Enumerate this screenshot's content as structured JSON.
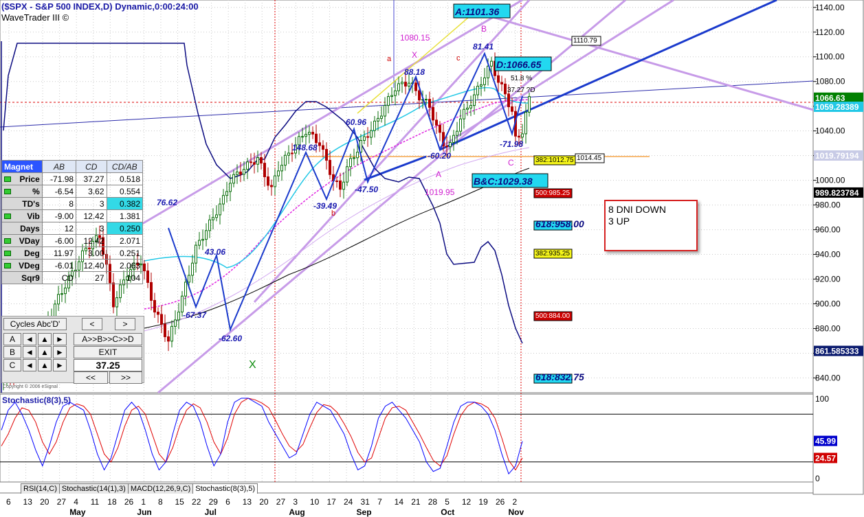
{
  "header": {
    "title": "($SPX - S&P 500 INDEX,D) Dynamic,0:00:24:00",
    "subtitle": "WaveTrader III ©"
  },
  "chart_data": {
    "type": "candlestick",
    "price_axis": {
      "ticks": [
        1140,
        1120,
        1100,
        1080,
        1060,
        1040,
        1020,
        1000,
        980,
        960,
        940,
        920,
        900,
        880,
        860,
        840
      ],
      "range": [
        828,
        1146
      ]
    },
    "price_axis_labels": [
      "1140.00",
      "1120.00",
      "1100.00",
      "1080.00",
      "1060.00",
      "1040.00",
      "1020.00",
      "1000.00",
      "980.00",
      "960.00",
      "940.00",
      "920.00",
      "900.00",
      "880.00",
      "860.00",
      "840.00"
    ],
    "value_tags": [
      {
        "text": "1066.63",
        "price": 1066.63,
        "color": "#008000",
        "text_color": "#ffffff"
      },
      {
        "text": "1059.28389",
        "price": 1059.28,
        "color": "#22c8e6",
        "text_color": "#ffffff"
      },
      {
        "text": "1019.79194",
        "price": 1019.79,
        "color": "#c8cbe6",
        "text_color": "#ffffff"
      },
      {
        "text": "989.823784",
        "price": 989.82,
        "color": "#000000",
        "text_color": "#ffffff"
      },
      {
        "text": "861.585333",
        "price": 861.59,
        "color": "#0a1a6e",
        "text_color": "#ffffff"
      }
    ],
    "x_day_labels": [
      "6",
      "13",
      "20",
      "27",
      "4",
      "11",
      "18",
      "26",
      "1",
      "8",
      "15",
      "22",
      "29",
      "6",
      "13",
      "20",
      "27",
      "3",
      "10",
      "17",
      "24",
      "31",
      "7",
      "14",
      "21",
      "28",
      "5",
      "12",
      "19",
      "26",
      "2"
    ],
    "x_month_labels": [
      {
        "text": "May",
        "day_index": 4
      },
      {
        "text": "Jun",
        "day_index": 8
      },
      {
        "text": "Jul",
        "day_index": 12
      },
      {
        "text": "Aug",
        "day_index": 17
      },
      {
        "text": "Sep",
        "day_index": 21
      },
      {
        "text": "Oct",
        "day_index": 26
      },
      {
        "text": "Nov",
        "day_index": 30
      }
    ],
    "price_path": [
      [
        0,
        838
      ],
      [
        6,
        850
      ],
      [
        12,
        880
      ],
      [
        16,
        905
      ],
      [
        20,
        925
      ],
      [
        24,
        945
      ],
      [
        28,
        955
      ],
      [
        30,
        930
      ],
      [
        32,
        900
      ],
      [
        36,
        925
      ],
      [
        40,
        935
      ],
      [
        44,
        895
      ],
      [
        48,
        870
      ],
      [
        52,
        905
      ],
      [
        56,
        945
      ],
      [
        60,
        965
      ],
      [
        64,
        985
      ],
      [
        66,
        1000
      ],
      [
        70,
        1010
      ],
      [
        74,
        1018
      ],
      [
        76,
        1004
      ],
      [
        78,
        993
      ],
      [
        80,
        1010
      ],
      [
        84,
        1025
      ],
      [
        88,
        1040
      ],
      [
        92,
        1030
      ],
      [
        96,
        1000
      ],
      [
        98,
        993
      ],
      [
        100,
        1010
      ],
      [
        104,
        1030
      ],
      [
        108,
        1045
      ],
      [
        112,
        1065
      ],
      [
        114,
        1075
      ],
      [
        118,
        1080
      ],
      [
        121,
        1068
      ],
      [
        124,
        1060
      ],
      [
        126,
        1043
      ],
      [
        128,
        1030
      ],
      [
        130,
        1028
      ],
      [
        133,
        1050
      ],
      [
        137,
        1068
      ],
      [
        140,
        1085
      ],
      [
        142,
        1095
      ],
      [
        144,
        1080
      ],
      [
        146,
        1070
      ],
      [
        148,
        1055
      ],
      [
        149,
        1033
      ],
      [
        151,
        1040
      ],
      [
        153,
        1066
      ]
    ],
    "oscillator": {
      "name": "Stochastic(8(3),5)",
      "axis_ticks": [
        100,
        0
      ],
      "levels": [
        80,
        20
      ],
      "value_tags": [
        {
          "text": "45.99",
          "value": 45.99,
          "color": "#0000cc"
        },
        {
          "text": "24.57",
          "value": 24.57,
          "color": "#d00000"
        }
      ],
      "k_series": [
        60,
        85,
        95,
        80,
        60,
        35,
        15,
        40,
        70,
        90,
        95,
        90,
        85,
        60,
        30,
        10,
        25,
        55,
        85,
        95,
        85,
        60,
        30,
        10,
        20,
        55,
        85,
        95,
        90,
        70,
        40,
        15,
        30,
        70,
        95,
        100,
        100,
        95,
        90,
        70,
        55,
        40,
        25,
        30,
        55,
        80,
        95,
        90,
        85,
        70,
        55,
        30,
        10,
        15,
        40,
        75,
        90,
        95,
        85,
        75,
        60,
        45,
        20,
        8,
        12,
        40,
        70,
        90,
        95,
        95,
        90,
        80,
        60,
        30,
        5,
        15,
        46
      ],
      "d_series": [
        40,
        55,
        75,
        88,
        85,
        70,
        45,
        30,
        45,
        70,
        88,
        93,
        90,
        80,
        55,
        30,
        20,
        38,
        65,
        85,
        90,
        80,
        55,
        30,
        20,
        38,
        65,
        85,
        93,
        88,
        70,
        45,
        30,
        50,
        80,
        95,
        100,
        98,
        94,
        88,
        72,
        55,
        40,
        33,
        42,
        63,
        82,
        92,
        90,
        82,
        68,
        52,
        32,
        20,
        25,
        50,
        75,
        88,
        90,
        85,
        70,
        55,
        38,
        22,
        15,
        28,
        55,
        78,
        90,
        95,
        93,
        88,
        75,
        50,
        22,
        10,
        25
      ]
    },
    "annotations": [
      {
        "text": "A:1101.36",
        "style": "box-cyan"
      },
      {
        "text": "D:1066.65",
        "style": "box-cyan"
      },
      {
        "text": "B&C:1029.38",
        "style": "box-cyan"
      },
      {
        "text": "1110.79",
        "style": "box-white"
      },
      {
        "text": "382:1012.75",
        "style": "box-yellow"
      },
      {
        "text": "1014.45",
        "style": "box-white"
      },
      {
        "text": "500:985.25",
        "style": "box-red"
      },
      {
        "text": "618:958.00",
        "style": "box-cyan"
      },
      {
        "text": "382:935.25",
        "style": "box-yellow"
      },
      {
        "text": "500:884.00",
        "style": "box-red"
      },
      {
        "text": "618:832.75",
        "style": "box-cyan"
      },
      {
        "text": "88.18",
        "style": "blue"
      },
      {
        "text": "81.41",
        "style": "blue"
      },
      {
        "text": "60.96",
        "style": "blue"
      },
      {
        "text": "148.68",
        "style": "blue"
      },
      {
        "text": "76.62",
        "style": "blue"
      },
      {
        "text": "43.06",
        "style": "blue"
      },
      {
        "text": "-67.37",
        "style": "blue"
      },
      {
        "text": "-62.60",
        "style": "blue"
      },
      {
        "text": "-39.49",
        "style": "blue"
      },
      {
        "text": "-47.50",
        "style": "blue"
      },
      {
        "text": "-60.20",
        "style": "blue"
      },
      {
        "text": "-71.98",
        "style": "blue"
      },
      {
        "text": "1080.15",
        "style": "magenta"
      },
      {
        "text": "1019.95",
        "style": "magenta"
      },
      {
        "text": "51.8 %",
        "style": "black"
      },
      {
        "text": "37.27 ?D",
        "style": "black"
      },
      {
        "text": "X",
        "style": "magenta"
      },
      {
        "text": "B",
        "style": "magenta"
      },
      {
        "text": "A",
        "style": "magenta"
      },
      {
        "text": "C",
        "style": "magenta"
      },
      {
        "text": "a",
        "style": "red"
      },
      {
        "text": "b",
        "style": "red"
      },
      {
        "text": "c",
        "style": "red"
      },
      {
        "text": "X",
        "style": "green"
      },
      {
        "text": "Copyright © 2006 eSignal",
        "style": "tiny"
      }
    ]
  },
  "magnet_table": {
    "headers": [
      "Magnet",
      "AB",
      "CD",
      "CD/AB"
    ],
    "rows": [
      {
        "label": "Price",
        "ab": "-71.98",
        "cd": "37.27",
        "ratio": "0.518",
        "led": true,
        "hl": false
      },
      {
        "label": "%",
        "ab": "-6.54",
        "cd": "3.62",
        "ratio": "0.554",
        "led": true,
        "hl": false
      },
      {
        "label": "TD's",
        "ab": "8",
        "cd": "3",
        "ratio": "0.382",
        "led": false,
        "hl": true
      },
      {
        "label": "Vib",
        "ab": "-9.00",
        "cd": "12.42",
        "ratio": "1.381",
        "led": true,
        "hl": false
      },
      {
        "label": "Days",
        "ab": "12",
        "cd": "3",
        "ratio": "0.250",
        "led": false,
        "hl": true
      },
      {
        "label": "VDay",
        "ab": "-6.00",
        "cd": "12.42",
        "ratio": "2.071",
        "led": true,
        "hl": false
      },
      {
        "label": "Deg",
        "ab": "11.97",
        "cd": "3.00",
        "ratio": "0.251",
        "led": true,
        "hl": false
      },
      {
        "label": "VDeg",
        "ab": "-6.01",
        "cd": "12.40",
        "ratio": "2.063",
        "led": true,
        "hl": false
      },
      {
        "label": "Sqr9",
        "ab": "CD",
        "cd": "27",
        "ratio": "104",
        "led": false,
        "hl": false
      }
    ]
  },
  "cycles_panel": {
    "title": "Cycles Abc'D'",
    "prev_arrow": "<",
    "next_arrow": ">",
    "row_labels": [
      "A",
      "B",
      "C"
    ],
    "abcd_button": "A>>B>>C>>D",
    "exit_button": "EXIT",
    "value": "37.25",
    "back_button": "<<",
    "fwd_button": ">>"
  },
  "note": {
    "line1": "8 DNI DOWN",
    "line2": "3 UP"
  },
  "bottom_tabs": [
    "RSI(14,C)",
    "Stochastic(14(1),3)",
    "MACD(12,26,9,C)",
    "Stochastic(8(3),5)"
  ],
  "colors": {
    "price_line": "#0a0a80",
    "candle_up": "#0a6e0a",
    "candle_down": "#b00000",
    "trend_blue": "#1a3acc",
    "channel_violet": "#c79be8",
    "fib_orange": "#f5a64a",
    "grid": "#c8c8c8",
    "stoch_k": "#0000ff",
    "stoch_d": "#e00000"
  }
}
